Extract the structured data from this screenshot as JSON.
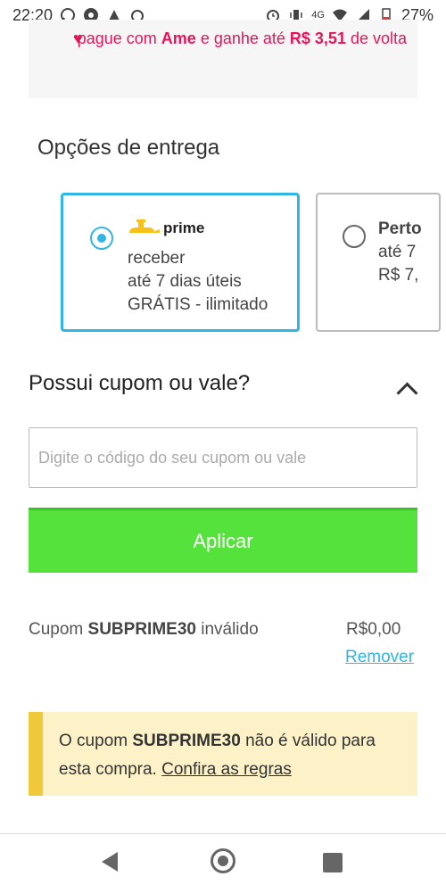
{
  "status_bar": {
    "time": "22:20",
    "network_label": "4G",
    "battery": "27%"
  },
  "promo": {
    "prefix": "pague com ",
    "brand": "Ame",
    "middle": " e ganhe até ",
    "amount": "R$ 3,51",
    "suffix": " de volta"
  },
  "delivery": {
    "title": "Opções de entrega",
    "options": [
      {
        "logo_text": "prime",
        "lines": [
          "receber",
          "até 7 dias úteis",
          "GRÁTIS - ilimitado"
        ],
        "selected": true
      },
      {
        "title": "Perto",
        "lines": [
          "até 7",
          "R$ 7,"
        ],
        "selected": false
      }
    ]
  },
  "coupon": {
    "title": "Possui cupom ou vale?",
    "input_placeholder": "Digite o código do seu cupom ou vale",
    "apply_label": "Aplicar",
    "status_prefix": "Cupom ",
    "code": "SUBPRIME30",
    "status_suffix": " inválido",
    "price": "R$0,00",
    "remove_label": "Remover",
    "alert_prefix": "O cupom ",
    "alert_code": "SUBPRIME30",
    "alert_middle": " não é válido para esta compra. ",
    "alert_link": "Confira as regras"
  },
  "colors": {
    "accent": "#2fb6e4",
    "apply": "#55e23c",
    "ame": "#e3155d",
    "alert_bg": "#fdf2c7",
    "alert_bar": "#f0c93a"
  }
}
